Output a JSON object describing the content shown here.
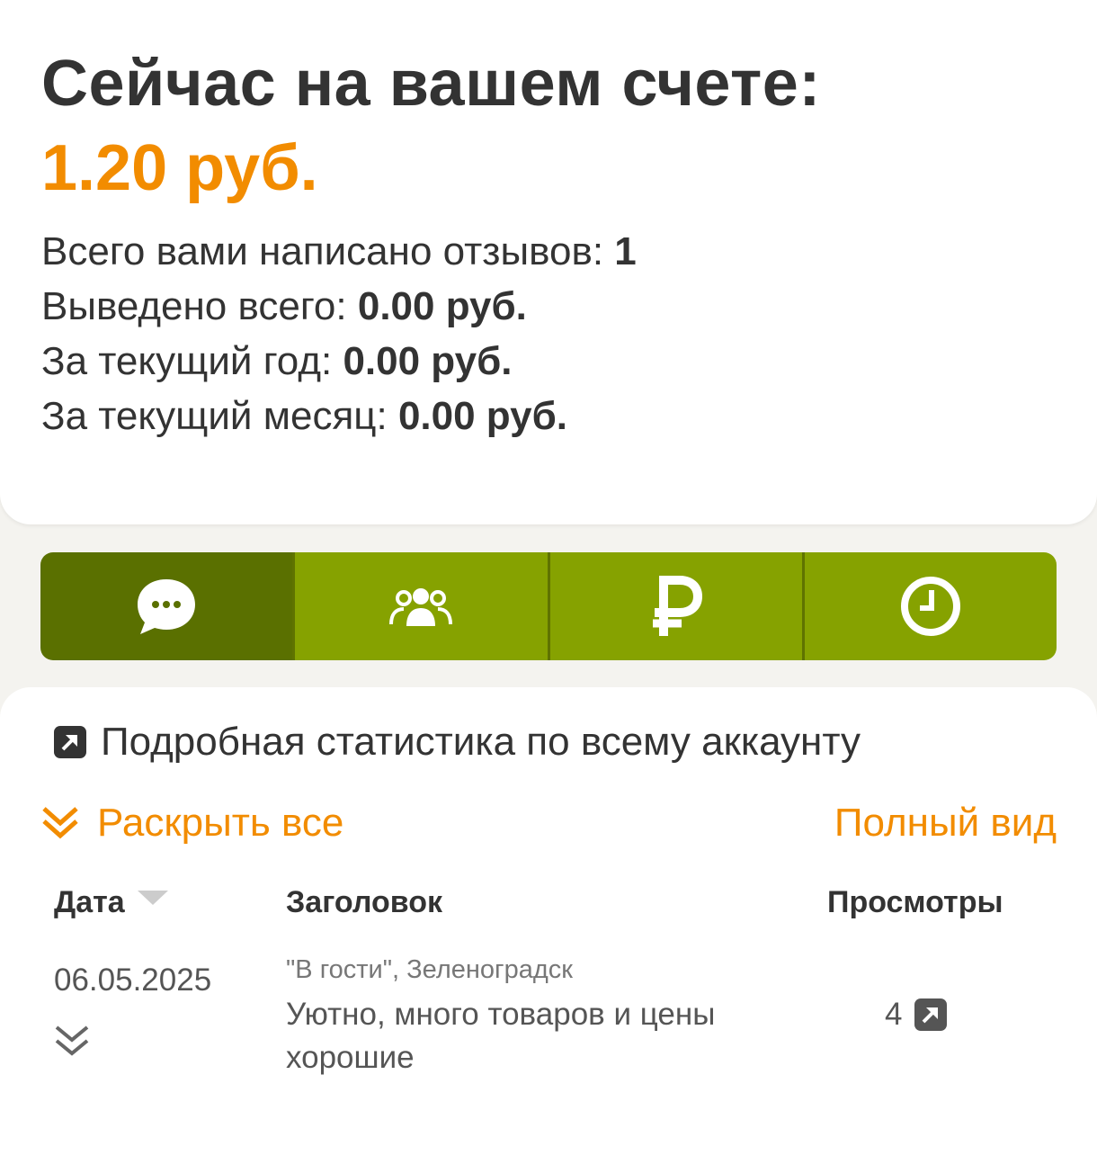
{
  "account": {
    "title": "Сейчас на вашем счете:",
    "balance": "1.20 руб."
  },
  "stats": [
    {
      "label": "Всего вами написано отзывов: ",
      "value": "1"
    },
    {
      "label": "Выведено всего: ",
      "value": "0.00 руб."
    },
    {
      "label": "За текущий год: ",
      "value": "0.00 руб."
    },
    {
      "label": "За текущий месяц: ",
      "value": "0.00 руб."
    }
  ],
  "tabs": [
    {
      "icon": "chat-bubble-icon",
      "active": true
    },
    {
      "icon": "users-group-icon",
      "active": false
    },
    {
      "icon": "ruble-icon",
      "active": false
    },
    {
      "icon": "clock-icon",
      "active": false
    }
  ],
  "links": {
    "detailed_stats": "Подробная статистика по всему аккаунту",
    "expand_all": "Раскрыть все",
    "full_view": "Полный вид"
  },
  "table": {
    "headers": {
      "date": "Дата",
      "title": "Заголовок",
      "views": "Просмотры"
    },
    "rows": [
      {
        "date": "06.05.2025",
        "place": "\"В гости\", Зеленоградск",
        "title": "Уютно, много товаров и цены хорошие",
        "views": "4"
      }
    ]
  },
  "colors": {
    "accent_orange": "#f28c00",
    "tab_green": "#86a200",
    "tab_active_green": "#5a7000",
    "text_dark": "#333333"
  }
}
